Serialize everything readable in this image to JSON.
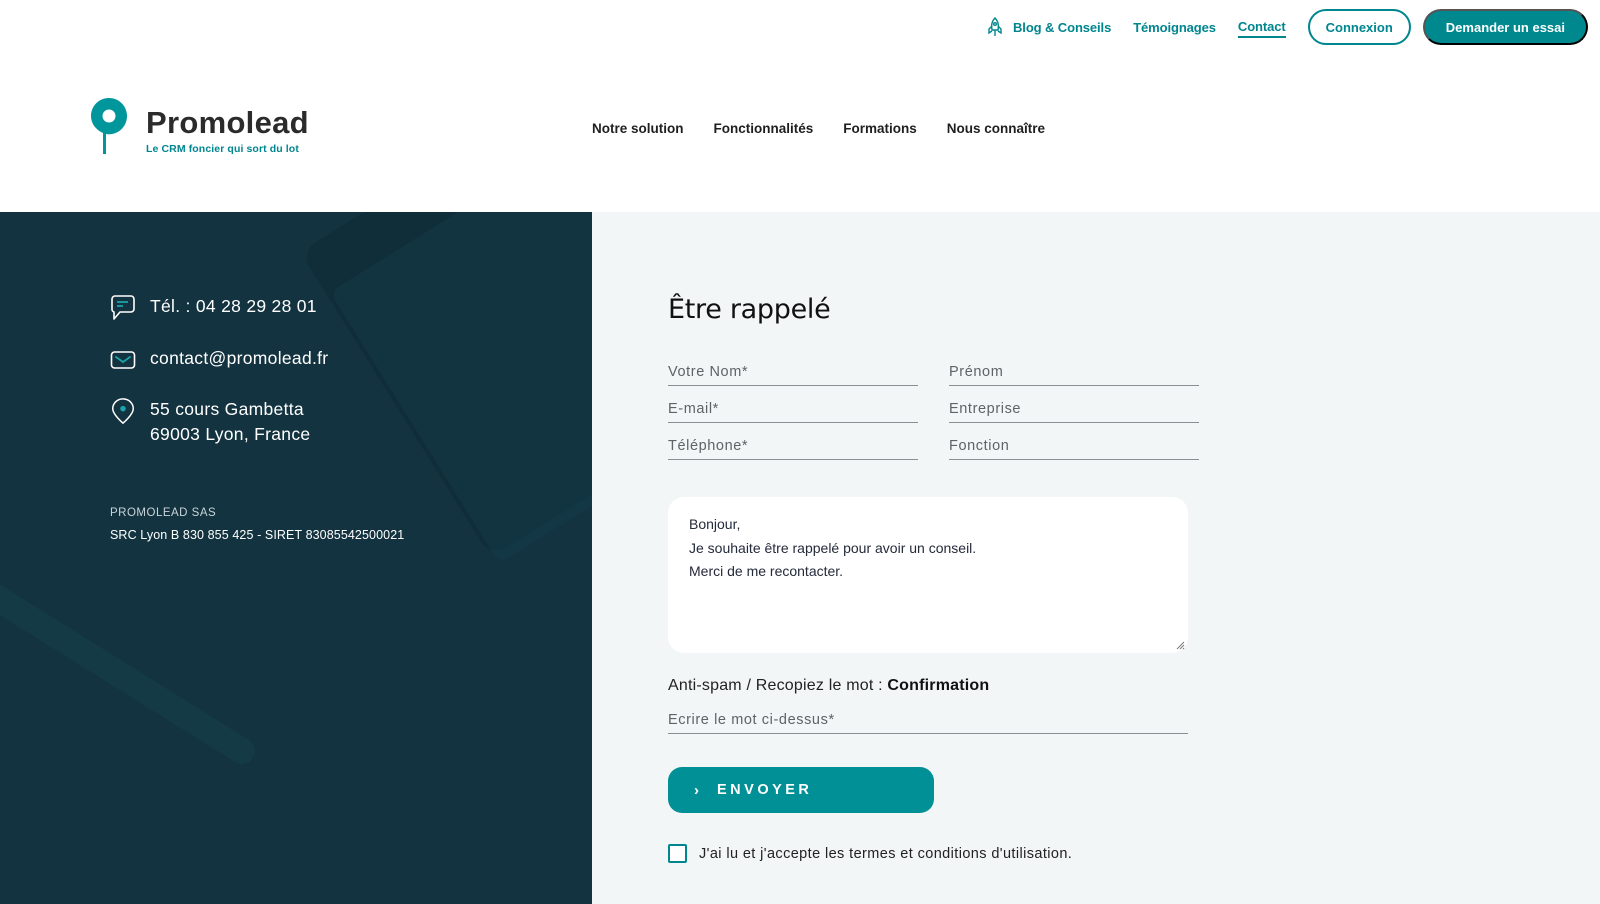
{
  "topbar": {
    "blog_label": "Blog & Conseils",
    "blog_icon": "rocket-icon",
    "testimonials_label": "Témoignages",
    "contact_label": "Contact",
    "login_label": "Connexion",
    "trial_label": "Demander un essai"
  },
  "brand": {
    "name": "Promolead",
    "tagline": "Le CRM foncier qui sort du lot",
    "icon": "map-pin-logo",
    "accent_color": "#00888f"
  },
  "nav": {
    "items": [
      {
        "label": "Notre solution"
      },
      {
        "label": "Fonctionnalités"
      },
      {
        "label": "Formations"
      },
      {
        "label": "Nous connaître"
      }
    ]
  },
  "contact_panel": {
    "phone": "Tél. : 04 28 29 28 01",
    "phone_icon": "chat-bubble-icon",
    "email": "contact@promolead.fr",
    "email_icon": "envelope-icon",
    "address_line1": "55 cours Gambetta",
    "address_line2": "69003 Lyon, France",
    "address_icon": "location-pin-icon",
    "company_name": "PROMOLEAD SAS",
    "company_registration": "SRC Lyon B 830 855 425 - SIRET 83085542500021"
  },
  "form": {
    "title": "Être rappelé",
    "fields": {
      "last_name": {
        "placeholder": "Votre Nom*",
        "value": ""
      },
      "first_name": {
        "placeholder": "Prénom",
        "value": ""
      },
      "email": {
        "placeholder": "E-mail*",
        "value": ""
      },
      "company": {
        "placeholder": "Entreprise",
        "value": ""
      },
      "phone": {
        "placeholder": "Téléphone*",
        "value": ""
      },
      "job": {
        "placeholder": "Fonction",
        "value": ""
      }
    },
    "message_lines": [
      "Bonjour,",
      "Je souhaite être rappelé pour avoir un conseil.",
      "Merci de me recontacter."
    ],
    "antispam_label": "Anti-spam / Recopiez le mot : ",
    "antispam_word": "Confirmation",
    "captcha_placeholder": "Ecrire le mot ci-dessus*",
    "submit_label": "ENVOYER",
    "submit_icon": "chevron-right-icon",
    "terms_label": "J'ai lu et j'accepte les termes et conditions d'utilisation.",
    "terms_checked": false
  }
}
